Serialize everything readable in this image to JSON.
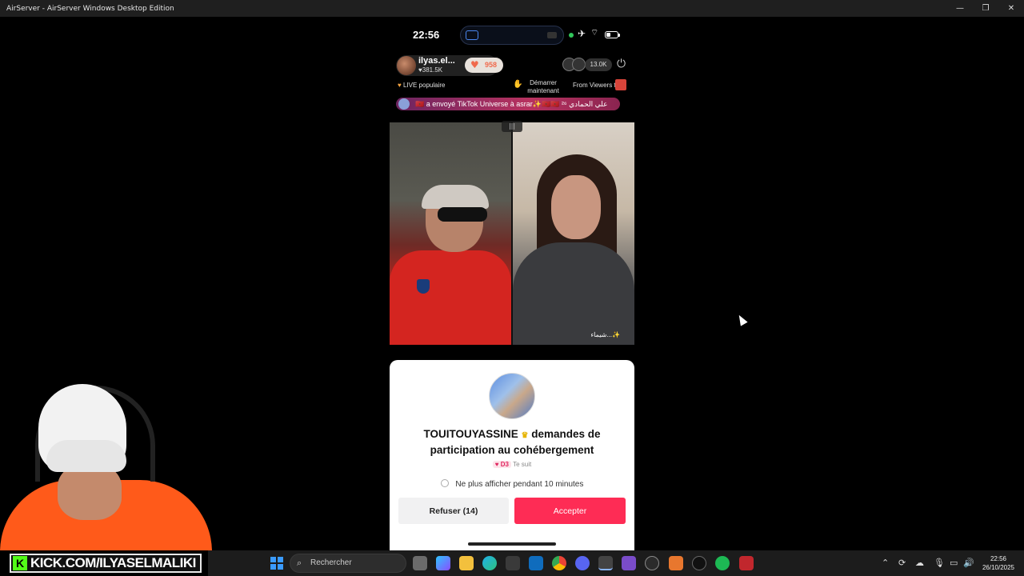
{
  "window": {
    "title": "AirServer - AirServer Windows Desktop Edition",
    "minimize": "—",
    "restore": "❐",
    "close": "✕"
  },
  "phone_status": {
    "time": "22:56",
    "battery_level": 0.35
  },
  "live_header": {
    "host_name": "ilyas.el...",
    "host_likes": "♥381.5K",
    "coins": "958",
    "viewer_count": "13.0K"
  },
  "info_line": {
    "live_popular": "LIVE populaire",
    "start_now": "Démarrer maintenant",
    "from_viewers": "From Viewers to"
  },
  "gift_banner": "🇲🇦 a envoyé TikTok Universe à asrar✨🇲🇦🇲🇦 علي الحمادي ²⁶",
  "video": {
    "split_icon": "|||",
    "guest_label": "شيماء...✨"
  },
  "request_modal": {
    "requester": "TOUITOUYASSINE",
    "crown": "♛",
    "title_rest": "demandes de participation au cohébergement",
    "level": "♥ D3",
    "follows": "Te suit",
    "mute_option": "Ne plus afficher pendant 10 minutes",
    "refuse_label": "Refuser (14)",
    "accept_label": "Accepter"
  },
  "overlay": {
    "kick_text": "KICK.COM/ILYASELMALIKI",
    "kick_logo": "K"
  },
  "taskbar": {
    "search_placeholder": "Rechercher",
    "clock_time": "22:56",
    "clock_date": "26/10/2025"
  },
  "colors": {
    "accent": "#fe2c55",
    "kick_green": "#53fc18"
  }
}
